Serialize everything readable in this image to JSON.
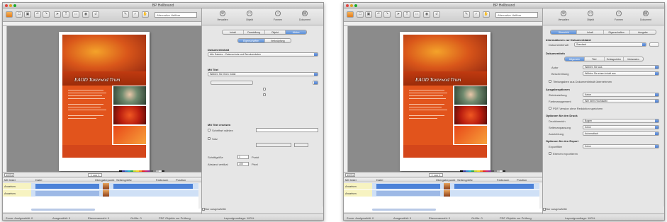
{
  "window_title": "BP Hellbound",
  "toolbar": {
    "field_value": "Alternative Heftbar"
  },
  "document": {
    "flyer_title": "EAOD Taxzewod Trum",
    "zoom": "100%",
    "page_indicator": "1 von 1"
  },
  "table": {
    "headers": [
      "Mit Datei",
      "Datei",
      "Übergabepunkt",
      "Seitengröße",
      "Farbraum",
      "Position"
    ],
    "rows": [
      {
        "col1": "Ansehen",
        "col2": "Datei"
      },
      {
        "col1": "Ansehen",
        "col2": ""
      }
    ]
  },
  "status_bar": {
    "items": [
      "Zoom: Auslgewählt: 0",
      "Ausgewählt: 0",
      "Ebenenanzahl: 0",
      "Größe: 0",
      "PDF Objekte zur Prüfung",
      "Layoutgrundlage: 100%"
    ]
  },
  "inspector_left": {
    "tools": [
      "Verwalten",
      "Objekt",
      "Formen",
      "Dokument"
    ],
    "tabs": [
      "Inhalt",
      "Darstellung",
      "Objekt",
      "Aktion"
    ],
    "subtabs": [
      "Eigenschaften",
      "Verknüpfung"
    ],
    "sections": {
      "source_label": "Dokumentinhalt",
      "source_value": "Alle Dateien - Datenschutz und Benutzerdaten",
      "fontset_label": "Mit Titel",
      "fontset_value": "Wählen Sie Ihren Inhalt",
      "replace_label": "Mit Titel ersetzen",
      "replace_option1": "Schriftart wählen",
      "replace_option2": "Satz",
      "size_label": "Schriftgröße",
      "size_value": "1",
      "spacing_label": "Abstand vertikal",
      "spacing_value": "100",
      "unit1": "Punkt",
      "unit2": "Pixel",
      "footer": "Nur ausgewählte"
    }
  },
  "inspector_right": {
    "tools": [
      "Verwalten",
      "Objekt",
      "Formen",
      "Dokument"
    ],
    "tabs": [
      "Übersicht",
      "Inhalt",
      "Eigenschaften",
      "Ausgabe"
    ],
    "sections": {
      "s1_label": "Informationen zur Dokumentdatei",
      "s1_field_label": "Dokumentinhalt",
      "s1_value": "Standard",
      "s2_label": "Dokumentinfo",
      "s2_tabs": [
        "Allgemein",
        "Titel",
        "Schlagwörter",
        "Metadaten"
      ],
      "row1_label": "Autor",
      "row1_value": "Wählen Sie aus",
      "row2_label": "Beschreibung",
      "row2_value": "Wählen Sie einen Inhalt aus",
      "check1": "Titelangaben aus Dokumentinhalt übernehmen",
      "s3_label": "Ausgabeoptionen",
      "row3_label": "Zieleinstellung",
      "row3_value": "Keine",
      "row4_label": "Farbmanagement",
      "row4_value": "Wie beim Hochladen",
      "check2": "PDF-Version ohne Reduktion speichern",
      "s4_label": "Optionen für den Druck",
      "row5_label": "Druckbereich",
      "row5_value": "Bogen",
      "row6_label": "Seitenanpassung",
      "row6_value": "Keine",
      "row7_label": "Ausrichtung",
      "row7_value": "Automatisch",
      "s5_label": "Optionen für den Export",
      "row8_label": "Exportfilter",
      "row8_value": "Keine",
      "check3": "Ebenen exportieren",
      "footer": "Nur ausgewählte"
    }
  }
}
